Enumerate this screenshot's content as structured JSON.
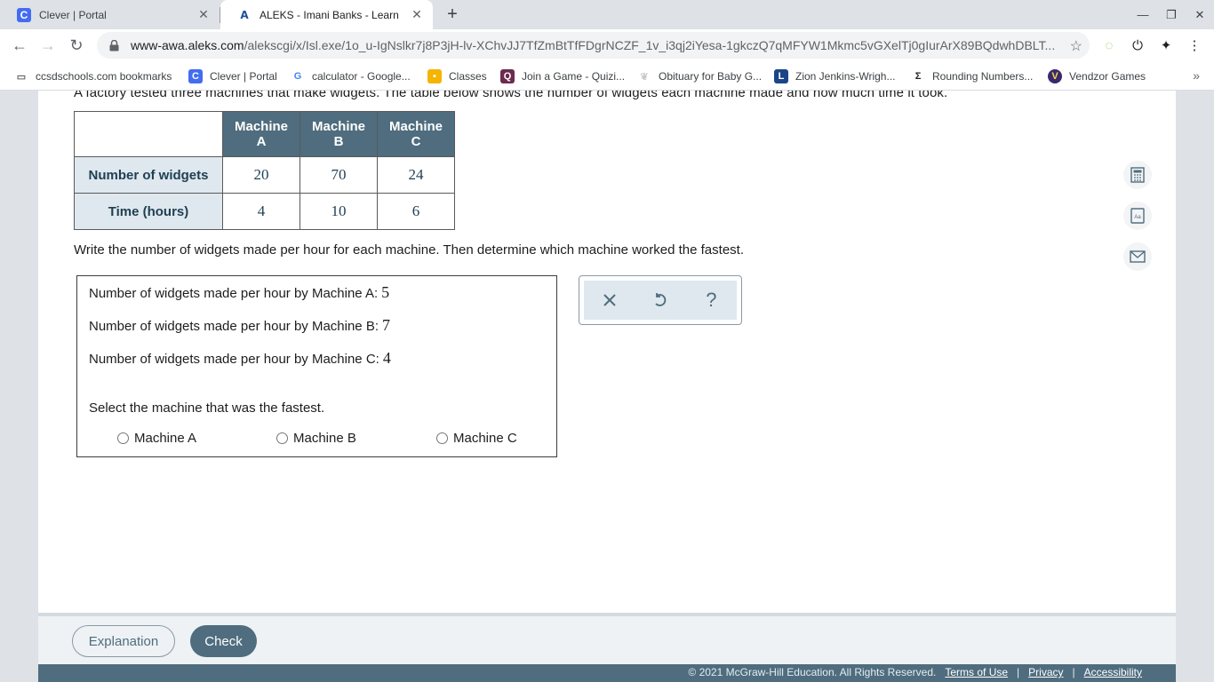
{
  "browser": {
    "tabs": [
      {
        "label": "Clever | Portal",
        "favicon": "C"
      },
      {
        "label": "ALEKS - Imani Banks - Learn",
        "favicon": "A"
      }
    ],
    "url_host": "www-awa.aleks.com",
    "url_path": "/alekscgi/x/Isl.exe/1o_u-IgNslkr7j8P3jH-lv-XChvJJ7TfZmBtTfFDgrNCZF_1v_i3qj2iYesa-1gkczQ7qMFYW1Mkmc5vGXelTj0gIurArX89BQdwhDBLT..."
  },
  "bookmarks": [
    {
      "label": "ccsdschools.com bookmarks",
      "icon": "folder-icon"
    },
    {
      "label": "Clever | Portal",
      "icon": "clever-icon"
    },
    {
      "label": "calculator - Google...",
      "icon": "google-icon"
    },
    {
      "label": "Classes",
      "icon": "classes-icon"
    },
    {
      "label": "Join a Game - Quizi...",
      "icon": "quizizz-icon"
    },
    {
      "label": "Obituary for Baby G...",
      "icon": "obituary-icon"
    },
    {
      "label": "Zion Jenkins-Wrigh...",
      "icon": "l-icon"
    },
    {
      "label": "Rounding Numbers...",
      "icon": "sigma-icon"
    },
    {
      "label": "Vendzor Games",
      "icon": "vendzor-icon"
    }
  ],
  "problem": {
    "text": "A factory tested three machines that make widgets. The table below shows the number of widgets each machine made and how much time it took.",
    "table": {
      "headers": [
        "Machine A",
        "Machine B",
        "Machine C"
      ],
      "header_lines": [
        [
          "Machine",
          "A"
        ],
        [
          "Machine",
          "B"
        ],
        [
          "Machine",
          "C"
        ]
      ],
      "rows": [
        {
          "label": "Number of widgets",
          "values": [
            "20",
            "70",
            "24"
          ]
        },
        {
          "label": "Time (hours)",
          "values": [
            "4",
            "10",
            "6"
          ]
        }
      ]
    },
    "instruction": "Write the number of widgets made per hour for each machine. Then determine which machine worked the fastest."
  },
  "answers": [
    {
      "label": "Number of widgets made per hour by Machine A:",
      "value": "5"
    },
    {
      "label": "Number of widgets made per hour by Machine B:",
      "value": "7"
    },
    {
      "label": "Number of widgets made per hour by Machine C:",
      "value": "4"
    }
  ],
  "select_prompt": "Select the machine that was the fastest.",
  "options": [
    "Machine A",
    "Machine B",
    "Machine C"
  ],
  "buttons": {
    "explanation": "Explanation",
    "check": "Check"
  },
  "footer": {
    "copyright": "© 2021 McGraw-Hill Education. All Rights Reserved.",
    "links": [
      "Terms of Use",
      "Privacy",
      "Accessibility"
    ],
    "separator": "|"
  },
  "colors": {
    "accent": "#4f6d7e",
    "header_bg": "#4f6d7e",
    "row_header_bg": "#dfe8ee"
  }
}
